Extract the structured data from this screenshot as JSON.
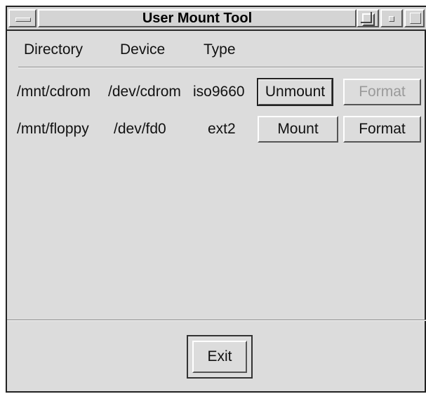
{
  "window": {
    "title": "User Mount Tool"
  },
  "columns": {
    "directory": "Directory",
    "device": "Device",
    "type": "Type"
  },
  "rows": [
    {
      "directory": "/mnt/cdrom",
      "device": "/dev/cdrom",
      "type": "iso9660",
      "action_label": "Unmount",
      "format_label": "Format",
      "format_enabled": false
    },
    {
      "directory": "/mnt/floppy",
      "device": "/dev/fd0",
      "type": "ext2",
      "action_label": "Mount",
      "format_label": "Format",
      "format_enabled": true
    }
  ],
  "footer": {
    "exit_label": "Exit"
  },
  "colors": {
    "background": "#dcdcdc",
    "disabled_text": "#9a9a9a",
    "border_dark": "#555555"
  }
}
